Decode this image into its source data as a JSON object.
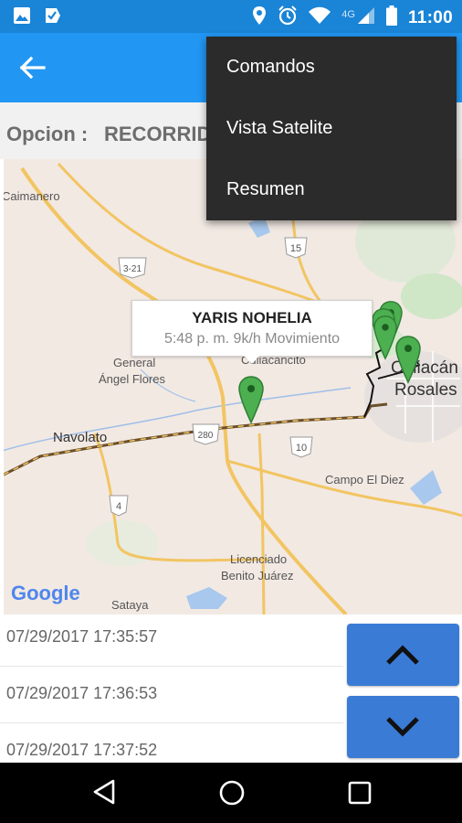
{
  "status_bar": {
    "time": "11:00",
    "network": "4G",
    "icons": [
      "image-icon",
      "check-badge-icon",
      "location-icon",
      "alarm-icon",
      "wifi-icon",
      "signal-icon",
      "battery-icon"
    ]
  },
  "app_bar": {
    "back_icon": "arrow-back-icon",
    "color": "#2196f3"
  },
  "option": {
    "label": "Opcion :",
    "value": "RECORRIDO"
  },
  "menu": {
    "items": [
      {
        "label": "Comandos"
      },
      {
        "label": "Vista Satelite"
      },
      {
        "label": "Resumen"
      }
    ]
  },
  "map": {
    "place_labels": [
      "Caimanero",
      "General",
      "Ángel Flores",
      "Culiacancito",
      "Navolato",
      "Campo El Diez",
      "Licenciado",
      "Benito Juárez",
      "Sataya",
      "Culiacán",
      "Rosales"
    ],
    "road_shields": [
      "15",
      "3-21",
      "280",
      "10",
      "4"
    ],
    "attribution": "Google",
    "info_window": {
      "title": "YARIS NOHELIA",
      "subtitle": "5:48 p. m. 9k/h Movimiento"
    },
    "marker_color": "#4caf50"
  },
  "records": {
    "items": [
      {
        "timestamp": "07/29/2017 17:35:57"
      },
      {
        "timestamp": "07/29/2017 17:36:53"
      },
      {
        "timestamp": "07/29/2017 17:37:52"
      }
    ]
  },
  "controls": {
    "up_icon": "chevron-up-icon",
    "down_icon": "chevron-down-icon",
    "button_color": "#3a7bd5"
  },
  "nav_bar": {
    "icons": [
      "back-triangle-icon",
      "home-circle-icon",
      "recents-square-icon"
    ]
  }
}
